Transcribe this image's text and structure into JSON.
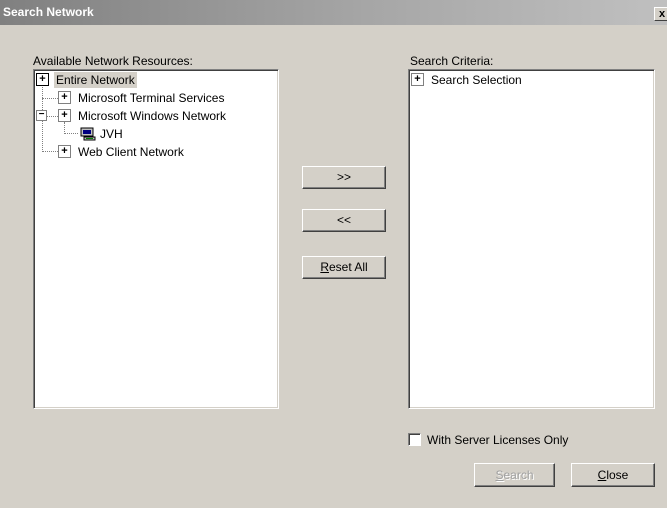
{
  "window": {
    "title": "Search Network",
    "close_glyph": "x"
  },
  "left_panel": {
    "label": "Available Network Resources:",
    "tree": [
      {
        "label": "Entire Network",
        "expander": "+",
        "selected": true
      },
      {
        "label": "Microsoft Terminal Services",
        "expander": "+"
      },
      {
        "label": "Microsoft Windows Network",
        "expander": "+",
        "expanded_glyph": "−"
      },
      {
        "label": "JVH",
        "icon": "computer-icon"
      },
      {
        "label": "Web Client Network",
        "expander": "+"
      }
    ]
  },
  "middle_buttons": {
    "add": ">>",
    "remove": "<<",
    "reset_prefix": "R",
    "reset_rest": "eset All"
  },
  "right_panel": {
    "label": "Search Criteria:",
    "tree": [
      {
        "label": "Search Selection",
        "expander": "+"
      }
    ]
  },
  "options": {
    "server_licenses_label": "With Server Licenses Only",
    "server_licenses_checked": false
  },
  "footer": {
    "search_prefix": "S",
    "search_rest": "earch",
    "search_enabled": false,
    "close_prefix": "C",
    "close_rest": "lose"
  },
  "colors": {
    "dialog_bg": "#d4d0c8",
    "list_bg": "#ffffff",
    "title_text": "#ffffff"
  }
}
